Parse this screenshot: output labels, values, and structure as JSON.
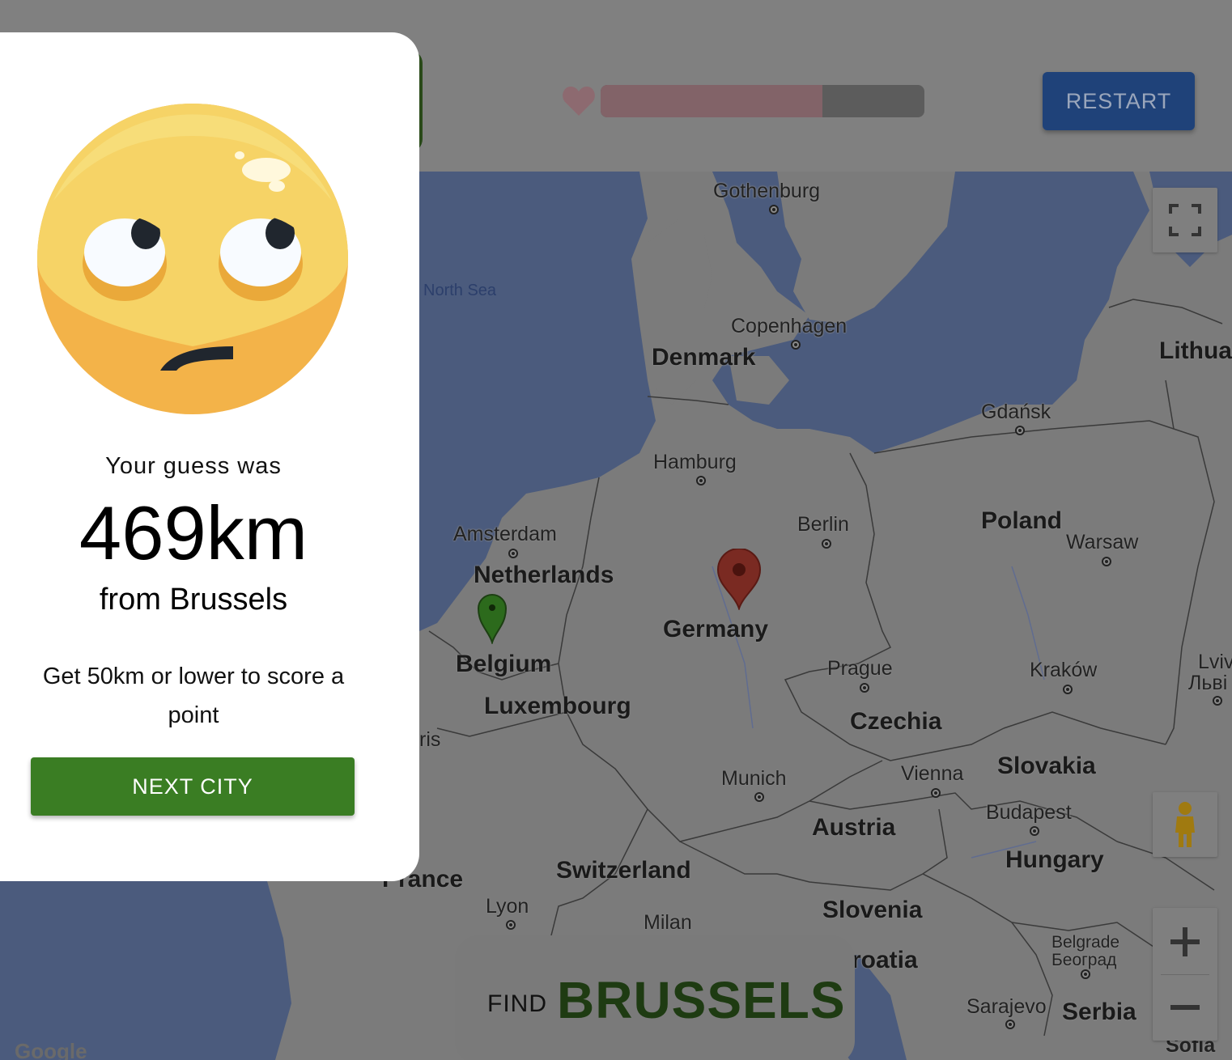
{
  "header": {
    "restart_label": "RESTART",
    "life_fraction": 0.685,
    "life_color": "#826368",
    "heart_icon": "heart-icon"
  },
  "map": {
    "sea_label": "North Sea",
    "countries": [
      "Denmark",
      "Netherlands",
      "Belgium",
      "Luxembourg",
      "Germany",
      "Poland",
      "Czechia",
      "Slovakia",
      "Austria",
      "Hungary",
      "Switzerland",
      "Slovenia",
      "Serbia",
      "Lithua",
      "Prance",
      "roatia"
    ],
    "cities": [
      "Gothenburg",
      "Copenhagen",
      "Hamburg",
      "Amsterdam",
      "Berlin",
      "Gdańsk",
      "Warsaw",
      "Prague",
      "Kraków",
      "Munich",
      "Vienna",
      "Budapest",
      "Lyon",
      "Milan",
      "Belgrade",
      "Београд",
      "Sarajevo",
      "Lviv",
      "Льві",
      "ris",
      "Sofia"
    ],
    "markers": {
      "actual": "green-pin",
      "guess": "red-pin"
    },
    "attribution": "Google"
  },
  "find": {
    "prefix": "FIND",
    "city": "BRUSSELS"
  },
  "result": {
    "intro": "Your guess was",
    "distance": "469km",
    "from": "from Brussels",
    "hint": "Get 50km or lower to score a point",
    "next_label": "NEXT CITY"
  },
  "colors": {
    "next_button": "#3a7d23",
    "restart_button": "#1f4279",
    "water": "#4b5b7d",
    "land": "#7b7b7b"
  }
}
